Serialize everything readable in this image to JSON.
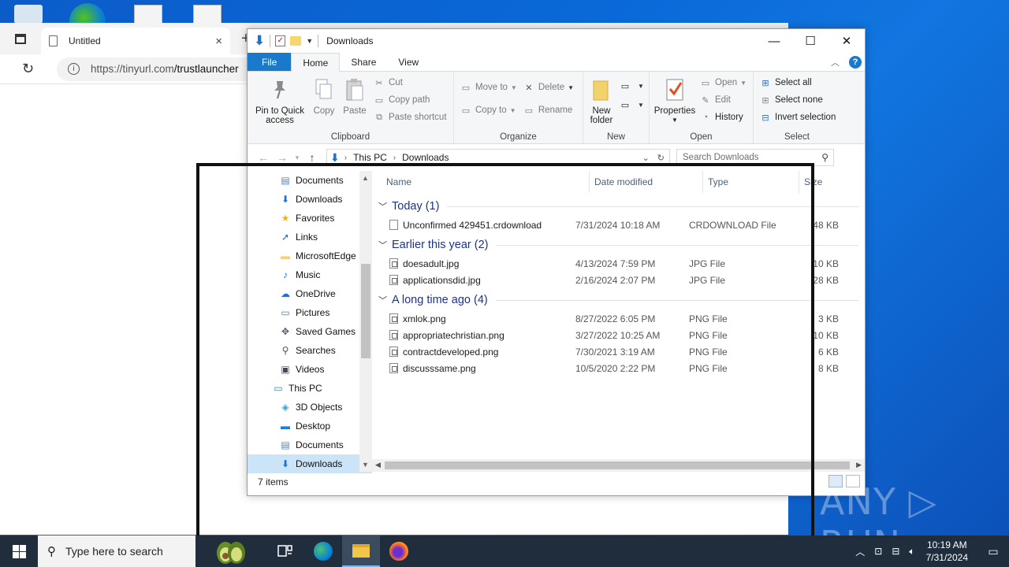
{
  "browser": {
    "tab_title": "Untitled",
    "tab_close": "×",
    "new_tab": "+",
    "refresh": "↻",
    "url_host": "https://tinyurl.com",
    "url_path": "/trustlauncher"
  },
  "explorer": {
    "title": "Downloads",
    "window_buttons": {
      "minimize": "—",
      "maximize": "☐",
      "close": "✕"
    },
    "ribbon_tabs": [
      "File",
      "Home",
      "Share",
      "View"
    ],
    "ribbon": {
      "clipboard": {
        "label": "Clipboard",
        "pin": "Pin to Quick\naccess",
        "copy": "Copy",
        "paste": "Paste",
        "cut": "Cut",
        "copy_path": "Copy path",
        "paste_shortcut": "Paste shortcut"
      },
      "organize": {
        "label": "Organize",
        "move_to": "Move to",
        "copy_to": "Copy to",
        "delete": "Delete",
        "rename": "Rename"
      },
      "new": {
        "label": "New",
        "new_folder": "New\nfolder"
      },
      "open": {
        "label": "Open",
        "properties": "Properties",
        "open": "Open",
        "edit": "Edit",
        "history": "History"
      },
      "select": {
        "label": "Select",
        "select_all": "Select all",
        "select_none": "Select none",
        "invert": "Invert selection"
      }
    },
    "path": [
      "This PC",
      "Downloads"
    ],
    "search_placeholder": "Search Downloads",
    "nav_items": [
      {
        "label": "Documents",
        "icon": "documents-icon",
        "indent": 2,
        "glyph": "▤",
        "color": "#5a7fb5"
      },
      {
        "label": "Downloads",
        "icon": "download-icon",
        "indent": 2,
        "glyph": "⬇",
        "color": "#1e6fd9"
      },
      {
        "label": "Favorites",
        "icon": "star-icon",
        "indent": 2,
        "glyph": "★",
        "color": "#e8b624"
      },
      {
        "label": "Links",
        "icon": "link-icon",
        "indent": 2,
        "glyph": "➚",
        "color": "#2a64b0"
      },
      {
        "label": "MicrosoftEdge",
        "icon": "folder-icon",
        "indent": 2,
        "glyph": "▬",
        "color": "#f3d37a"
      },
      {
        "label": "Music",
        "icon": "music-icon",
        "indent": 2,
        "glyph": "♪",
        "color": "#1e6fd9"
      },
      {
        "label": "OneDrive",
        "icon": "cloud-icon",
        "indent": 2,
        "glyph": "☁",
        "color": "#1e6fd9"
      },
      {
        "label": "Pictures",
        "icon": "pictures-icon",
        "indent": 2,
        "glyph": "▭",
        "color": "#4d7fb8"
      },
      {
        "label": "Saved Games",
        "icon": "saved-games-icon",
        "indent": 2,
        "glyph": "✥",
        "color": "#556"
      },
      {
        "label": "Searches",
        "icon": "search-icon",
        "indent": 2,
        "glyph": "⚲",
        "color": "#555"
      },
      {
        "label": "Videos",
        "icon": "video-icon",
        "indent": 2,
        "glyph": "▣",
        "color": "#445"
      },
      {
        "label": "This PC",
        "icon": "computer-icon",
        "indent": 1,
        "glyph": "▭",
        "color": "#2a7fd8"
      },
      {
        "label": "3D Objects",
        "icon": "cube-icon",
        "indent": 2,
        "glyph": "◈",
        "color": "#3aa0d8"
      },
      {
        "label": "Desktop",
        "icon": "desktop-icon",
        "indent": 2,
        "glyph": "▬",
        "color": "#1e7fd9"
      },
      {
        "label": "Documents",
        "icon": "documents-icon",
        "indent": 2,
        "glyph": "▤",
        "color": "#5a7fb5"
      },
      {
        "label": "Downloads",
        "icon": "download-icon",
        "indent": 2,
        "glyph": "⬇",
        "color": "#1e6fd9",
        "selected": true
      }
    ],
    "columns": {
      "name": "Name",
      "date": "Date modified",
      "type": "Type",
      "size": "Size"
    },
    "groups": [
      {
        "label": "Today (1)",
        "files": [
          {
            "name": "Unconfirmed 429451.crdownload",
            "date": "7/31/2024 10:18 AM",
            "type": "CRDOWNLOAD File",
            "size": "48 KB",
            "kind": "doc"
          }
        ]
      },
      {
        "label": "Earlier this year (2)",
        "files": [
          {
            "name": "doesadult.jpg",
            "date": "4/13/2024 7:59 PM",
            "type": "JPG File",
            "size": "10 KB",
            "kind": "img"
          },
          {
            "name": "applicationsdid.jpg",
            "date": "2/16/2024 2:07 PM",
            "type": "JPG File",
            "size": "28 KB",
            "kind": "img"
          }
        ]
      },
      {
        "label": "A long time ago (4)",
        "files": [
          {
            "name": "xmlok.png",
            "date": "8/27/2022 6:05 PM",
            "type": "PNG File",
            "size": "3 KB",
            "kind": "img"
          },
          {
            "name": "appropriatechristian.png",
            "date": "3/27/2022 10:25 AM",
            "type": "PNG File",
            "size": "10 KB",
            "kind": "img"
          },
          {
            "name": "contractdeveloped.png",
            "date": "7/30/2021 3:19 AM",
            "type": "PNG File",
            "size": "6 KB",
            "kind": "img"
          },
          {
            "name": "discusssame.png",
            "date": "10/5/2020 2:22 PM",
            "type": "PNG File",
            "size": "8 KB",
            "kind": "img"
          }
        ]
      }
    ],
    "status_text": "7 items"
  },
  "watermark": "ANY ▷ RUN",
  "taskbar": {
    "search_placeholder": "Type here to search",
    "time": "10:19 AM",
    "date": "7/31/2024"
  }
}
